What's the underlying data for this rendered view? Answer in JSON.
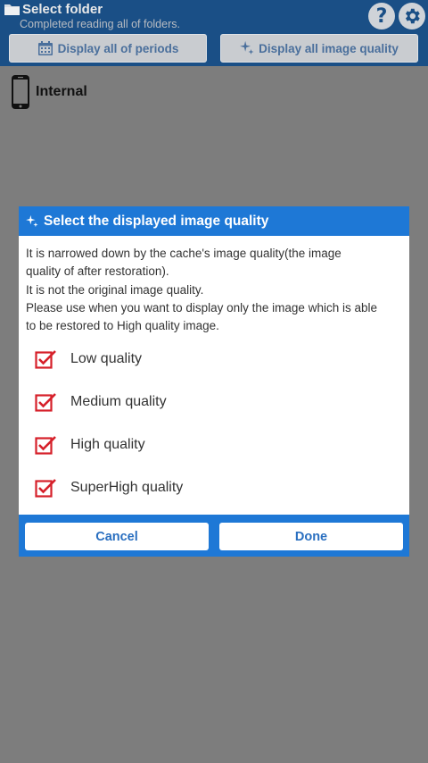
{
  "header": {
    "title": "Select folder",
    "subtitle": "Completed reading all of folders.",
    "help_label": "?",
    "period_button": "Display all of periods",
    "quality_button": "Display all image quality"
  },
  "storage": {
    "label": "Internal"
  },
  "dialog": {
    "title": "Select the displayed image quality",
    "description": [
      "It is narrowed down by the cache's image quality(the image",
      "quality of after restoration).",
      "It is not the original image quality.",
      "Please use when you want to display only the image which is able",
      "to be restored to High quality image."
    ],
    "options": [
      {
        "label": "Low quality",
        "checked": true
      },
      {
        "label": "Medium quality",
        "checked": true
      },
      {
        "label": "High quality",
        "checked": true
      },
      {
        "label": "SuperHigh quality",
        "checked": true
      }
    ],
    "cancel_label": "Cancel",
    "done_label": "Done"
  },
  "colors": {
    "header_bg": "#1a4f86",
    "dialog_accent": "#1e78d6",
    "check_red": "#d6202a",
    "overlay": "#7d7d7d"
  }
}
